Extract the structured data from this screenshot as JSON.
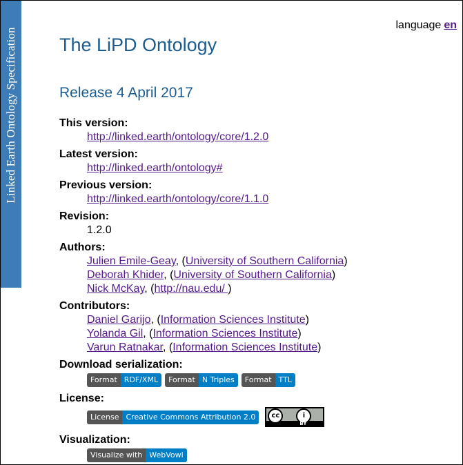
{
  "sidebar": {
    "text": "Linked Earth Ontology Specification"
  },
  "language": {
    "label": "language",
    "current": "en"
  },
  "title": "The LiPD Ontology",
  "release": "Release 4 April 2017",
  "this_version": {
    "label": "This version:",
    "url": "http://linked.earth/ontology/core/1.2.0"
  },
  "latest_version": {
    "label": "Latest version:",
    "url": "http://linked.earth/ontology#"
  },
  "previous_version": {
    "label": "Previous version:",
    "url": "http://linked.earth/ontology/core/1.1.0"
  },
  "revision": {
    "label": "Revision:",
    "value": "1.2.0"
  },
  "authors": {
    "label": "Authors:",
    "items": [
      {
        "name": "Julien Emile-Geay",
        "affiliation": "University of Southern California"
      },
      {
        "name": "Deborah Khider",
        "affiliation": "University of Southern California"
      },
      {
        "name": "Nick McKay",
        "affiliation": "http://nau.edu/ "
      }
    ]
  },
  "contributors": {
    "label": "Contributors:",
    "items": [
      {
        "name": "Daniel Garijo",
        "affiliation": "Information Sciences Institute"
      },
      {
        "name": "Yolanda Gil",
        "affiliation": "Information Sciences Institute"
      },
      {
        "name": "Varun Ratnakar",
        "affiliation": "Information Sciences Institute"
      }
    ]
  },
  "download": {
    "label": "Download serialization:",
    "badges": [
      {
        "left": "Format",
        "right": "RDF/XML"
      },
      {
        "left": "Format",
        "right": "N Triples"
      },
      {
        "left": "Format",
        "right": "TTL"
      }
    ]
  },
  "license": {
    "label": "License:",
    "badge": {
      "left": "License",
      "right": "Creative Commons Attribution 2.0"
    },
    "logo": {
      "left": "cc",
      "right": "i",
      "bottom": "BY"
    }
  },
  "visualization": {
    "label": "Visualization:",
    "badge": {
      "left": "Visualize with",
      "right": "WebVowl"
    }
  },
  "colors": {
    "heading": "#1c5c8e",
    "sidebar": "#3d7cb6",
    "link": "#551a8b",
    "badge_left": "#555555",
    "badge_right": "#007ec6"
  }
}
